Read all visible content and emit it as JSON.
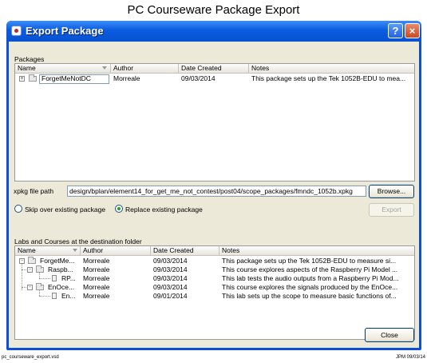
{
  "doc": {
    "title": "PC Courseware Package Export",
    "footer_left": "pc_courseware_export.vsd",
    "footer_right": "JPM 09/03/14"
  },
  "window": {
    "title": "Export Package",
    "help_label": "?",
    "close_label": "×"
  },
  "packages": {
    "label": "Packages",
    "columns": [
      "Name",
      "Author",
      "Date Created",
      "Notes"
    ],
    "rows": [
      {
        "name": "ForgetMeNotDC",
        "author": "Morreale",
        "date": "09/03/2014",
        "notes": "This package sets up the Tek 1052B-EDU to mea..."
      }
    ]
  },
  "file": {
    "label": "xpkg file path",
    "value": "design/bplan/element14_for_get_me_not_contest/post04/scope_packages/fmndc_1052b.xpkg",
    "browse_label": "Browse..."
  },
  "options": {
    "skip_label": "Skip over existing package",
    "replace_label": "Replace existing package",
    "selected": "replace",
    "export_label": "Export"
  },
  "labs": {
    "label": "Labs and Courses at the destination folder",
    "columns": [
      "Name",
      "Author",
      "Date Created",
      "Notes"
    ],
    "rows": [
      {
        "name": "ForgetMe...",
        "author": "Morreale",
        "date": "09/03/2014",
        "notes": "This package sets up the Tek 1052B-EDU to measure si..."
      },
      {
        "name": "Raspb...",
        "author": "Morreale",
        "date": "09/03/2014",
        "notes": "This course explores aspects of the Raspberry Pi Model ..."
      },
      {
        "name": "RP...",
        "author": "Morreale",
        "date": "09/03/2014",
        "notes": "This lab tests the audio outputs from a Raspberry Pi Mod..."
      },
      {
        "name": "EnOce...",
        "author": "Morreale",
        "date": "09/03/2014",
        "notes": "This course explores the signals produced by the EnOce..."
      },
      {
        "name": "En...",
        "author": "Morreale",
        "date": "09/01/2014",
        "notes": "This lab sets up the scope to measure basic functions of..."
      }
    ],
    "close_label": "Close"
  }
}
